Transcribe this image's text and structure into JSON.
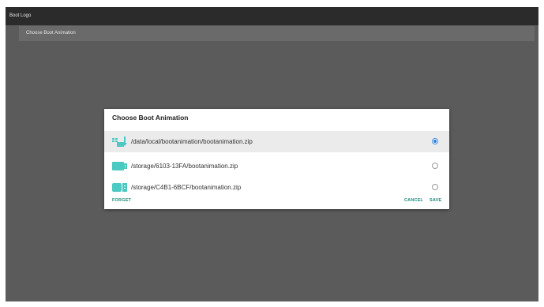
{
  "header": {
    "title": "Boot Logo"
  },
  "settings": {
    "item_label": "Choose Boot Animation"
  },
  "dialog": {
    "title": "Choose Boot Animation",
    "options": [
      {
        "label": "/data/local/bootanimation/bootanimation.zip",
        "icon": "internal-storage-icon",
        "selected": true
      },
      {
        "label": "/storage/6103-13FA/bootanimation.zip",
        "icon": "usb-drive-icon",
        "selected": false
      },
      {
        "label": "/storage/C4B1-6BCF/bootanimation.zip",
        "icon": "usb-drive-icon",
        "selected": false
      }
    ],
    "buttons": {
      "forget": "FORGET",
      "cancel": "CANCEL",
      "save": "SAVE"
    }
  },
  "colors": {
    "background": "#5b5b5b",
    "titlebar": "#2b2b2b",
    "accent": "#1e8c7e",
    "icon_teal": "#4cc9c0",
    "radio_selected": "#2f7fe0"
  }
}
